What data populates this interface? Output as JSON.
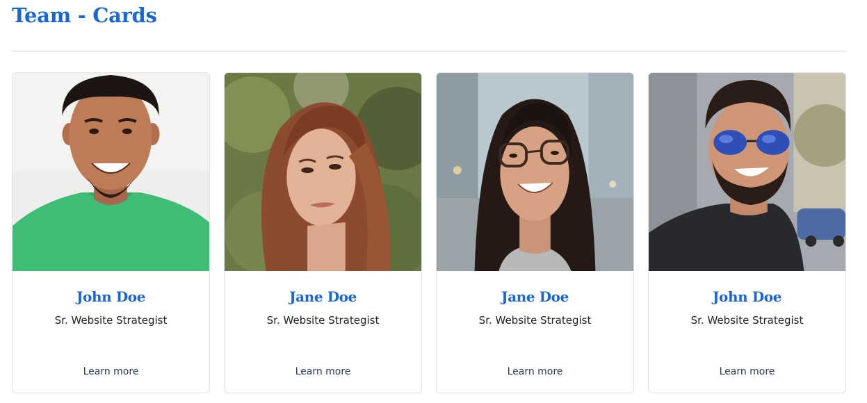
{
  "page": {
    "title": "Team - Cards"
  },
  "colors": {
    "accent": "#1a66d2",
    "divider": "#cfcfcf",
    "card_border": "#e3e3e3"
  },
  "team": [
    {
      "name": "John Doe",
      "role": "Sr. Website Strategist",
      "link_label": "Learn more",
      "photo": "smiling-man-green-shirt"
    },
    {
      "name": "Jane Doe",
      "role": "Sr. Website Strategist",
      "link_label": "Learn more",
      "photo": "woman-auburn-hair"
    },
    {
      "name": "Jane Doe",
      "role": "Sr. Website Strategist",
      "link_label": "Learn more",
      "photo": "woman-glasses-city"
    },
    {
      "name": "John Doe",
      "role": "Sr. Website Strategist",
      "link_label": "Learn more",
      "photo": "man-sunglasses-beard"
    }
  ]
}
